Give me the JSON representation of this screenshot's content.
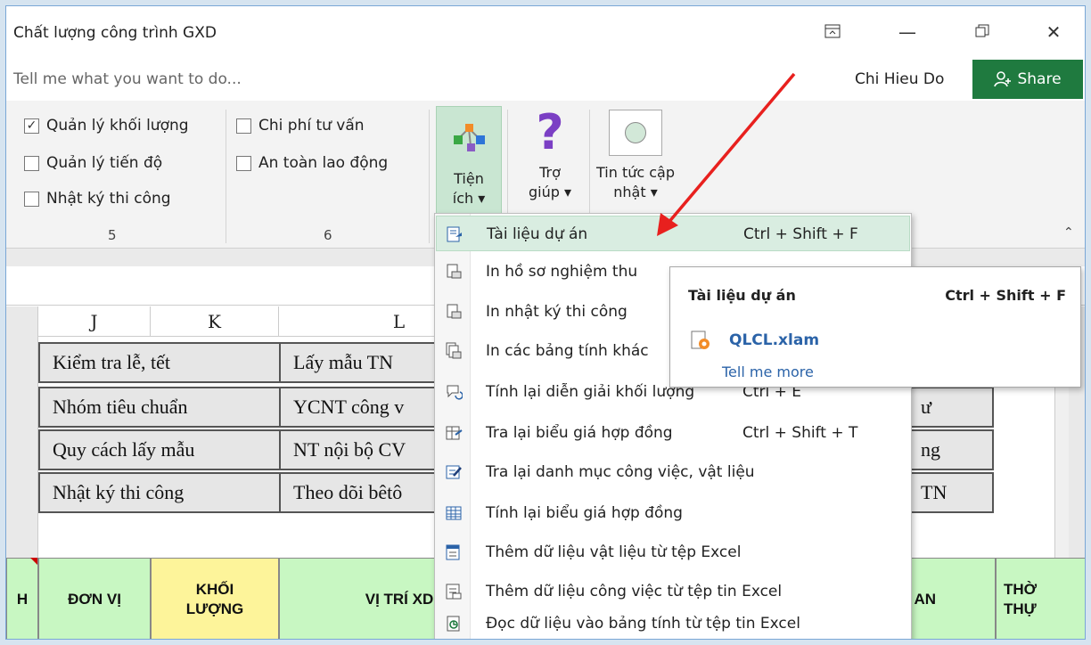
{
  "window": {
    "title": "Chất lượng công trình GXD"
  },
  "tellme": {
    "placeholder": "Tell me what you want to do...",
    "user": "Chi Hieu Do",
    "share": "Share"
  },
  "ribbon": {
    "group5": {
      "label": "5",
      "checks": [
        {
          "label": "Quản lý khối lượng",
          "checked": true
        },
        {
          "label": "Quản lý tiến độ",
          "checked": false
        },
        {
          "label": "Nhật ký thi công",
          "checked": false
        }
      ]
    },
    "group6": {
      "label": "6",
      "checks": [
        {
          "label": "Chi phí tư vấn",
          "checked": false
        },
        {
          "label": "An toàn lao động",
          "checked": false
        }
      ]
    },
    "tienich": {
      "line1": "Tiện",
      "line2": "ích ▾"
    },
    "trogiup": {
      "line1": "Trợ",
      "line2": "giúp ▾"
    },
    "tintuc": {
      "line1": "Tin tức cập",
      "line2": "nhật ▾"
    }
  },
  "grid": {
    "columns": [
      "J",
      "K",
      "L"
    ],
    "rows": [
      {
        "left": "Kiểm tra lễ, tết",
        "mid": "Lấy mẫu TN",
        "right": ""
      },
      {
        "left": "Nhóm tiêu chuẩn",
        "mid": "YCNT công v",
        "right": "ư"
      },
      {
        "left": "Quy cách lấy mẫu",
        "mid": "NT nội bộ CV",
        "right": "ng"
      },
      {
        "left": "Nhật ký thi công",
        "mid": "Theo dõi bêtô",
        "right": "TN"
      }
    ],
    "headers": {
      "h0": "H",
      "h1": "ĐƠN VỊ",
      "h2_1": "KHỐI",
      "h2_2": "LƯỢNG",
      "h3": "VỊ TRÍ XD",
      "h4": "AN",
      "h5_1": "THỜ",
      "h5_2": "THỰ"
    }
  },
  "menu": {
    "items": [
      {
        "label": "Tài liệu dự án",
        "shortcut": "Ctrl + Shift + F"
      },
      {
        "label": "In hồ sơ nghiệm thu",
        "shortcut": ""
      },
      {
        "label": "In nhật ký thi công",
        "shortcut": ""
      },
      {
        "label": "In các bảng tính khác",
        "shortcut": ""
      },
      {
        "label": "Tính lại diễn giải khối lượng",
        "shortcut": "Ctrl + E"
      },
      {
        "label": "Tra lại biểu giá hợp đồng",
        "shortcut": "Ctrl + Shift + T"
      },
      {
        "label": "Tra lại danh mục công việc, vật liệu",
        "shortcut": ""
      },
      {
        "label": "Tính lại biểu giá hợp đồng",
        "shortcut": ""
      },
      {
        "label": "Thêm dữ liệu vật liệu từ tệp Excel",
        "shortcut": ""
      },
      {
        "label": "Thêm dữ liệu công việc từ tệp tin Excel",
        "shortcut": ""
      },
      {
        "label": "Đọc dữ liệu vào bảng tính từ tệp tin Excel",
        "shortcut": ""
      }
    ]
  },
  "tooltip": {
    "title": "Tài liệu dự án",
    "shortcut": "Ctrl + Shift + F",
    "addin": "QLCL.xlam",
    "link": "Tell me more"
  },
  "colors": {
    "accent": "#1f7a3f",
    "highlight": "#d9ede1",
    "yellow": "#fdf49a",
    "green": "#c8f7c2",
    "arrow": "#e8201e"
  }
}
